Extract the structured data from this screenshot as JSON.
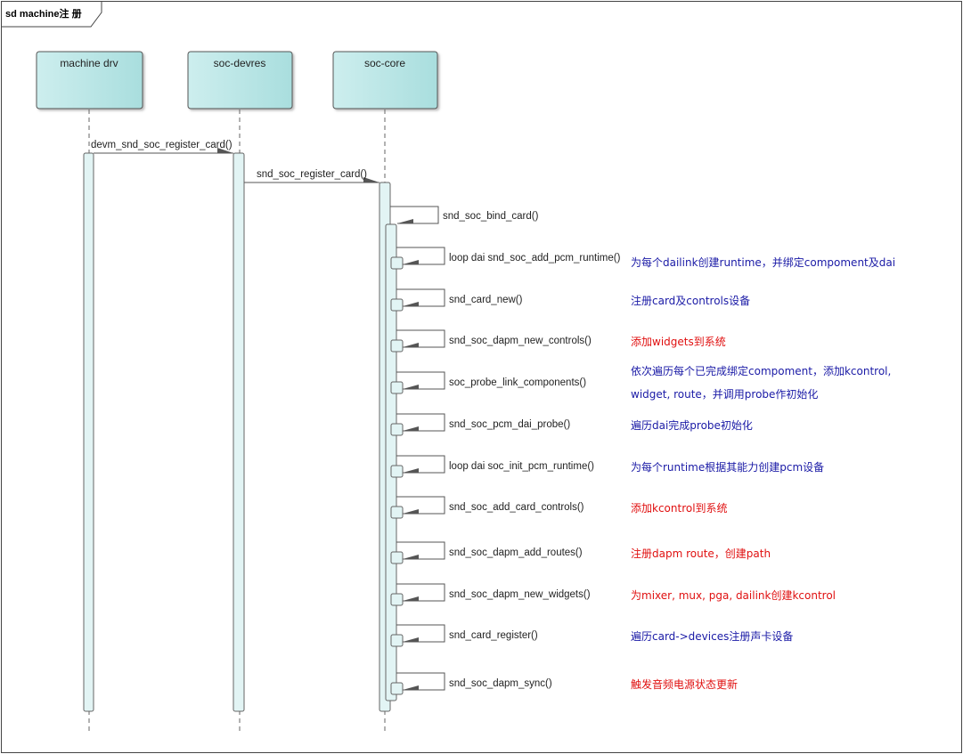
{
  "frame": {
    "title": "sd machine注 册"
  },
  "participants": [
    {
      "id": "machine",
      "label": "machine drv"
    },
    {
      "id": "devres",
      "label": "soc-devres"
    },
    {
      "id": "core",
      "label": "soc-core"
    }
  ],
  "messages": [
    {
      "id": "m1",
      "label": "devm_snd_soc_register_card()",
      "from": "machine",
      "to": "devres"
    },
    {
      "id": "m2",
      "label": "snd_soc_register_card()",
      "from": "devres",
      "to": "core"
    }
  ],
  "self_calls": [
    {
      "id": "s0",
      "label": "snd_soc_bind_card()",
      "note": "",
      "note_color": ""
    },
    {
      "id": "s1",
      "label": "loop dai snd_soc_add_pcm_runtime()",
      "note": "为每个dailink创建runtime，并绑定compoment及dai",
      "note_color": "#1a1aa6"
    },
    {
      "id": "s2",
      "label": "snd_card_new()",
      "note": "注册card及controls设备",
      "note_color": "#1a1aa6"
    },
    {
      "id": "s3",
      "label": "snd_soc_dapm_new_controls()",
      "note": "添加widgets到系统",
      "note_color": "#e01010"
    },
    {
      "id": "s4",
      "label": "soc_probe_link_components()",
      "note": "依次遍历每个已完成绑定compoment，添加kcontrol,",
      "note2": "widget, route，并调用probe作初始化",
      "note_color": "#1a1aa6"
    },
    {
      "id": "s5",
      "label": "snd_soc_pcm_dai_probe()",
      "note": "遍历dai完成probe初始化",
      "note_color": "#1a1aa6"
    },
    {
      "id": "s6",
      "label": "loop dai soc_init_pcm_runtime()",
      "note": "为每个runtime根据其能力创建pcm设备",
      "note_color": "#1a1aa6"
    },
    {
      "id": "s7",
      "label": "snd_soc_add_card_controls()",
      "note": "添加kcontrol到系统",
      "note_color": "#e01010"
    },
    {
      "id": "s8",
      "label": "snd_soc_dapm_add_routes()",
      "note": "注册dapm route，创建path",
      "note_color": "#e01010"
    },
    {
      "id": "s9",
      "label": "snd_soc_dapm_new_widgets()",
      "note": "为mixer, mux, pga, dailink创建kcontrol",
      "note_color": "#e01010"
    },
    {
      "id": "s10",
      "label": "snd_card_register()",
      "note": "遍历card->devices注册声卡设备",
      "note_color": "#1a1aa6"
    },
    {
      "id": "s11",
      "label": "snd_soc_dapm_sync()",
      "note": "触发音频电源状态更新",
      "note_color": "#e01010"
    }
  ],
  "colors": {
    "participant_fill": "#cdeeee",
    "participant_fill_dark": "#a9dede",
    "activation_fill": "#e2f4f4",
    "line": "#555555",
    "blue_note": "#1a1aa6",
    "red_note": "#e01010"
  }
}
